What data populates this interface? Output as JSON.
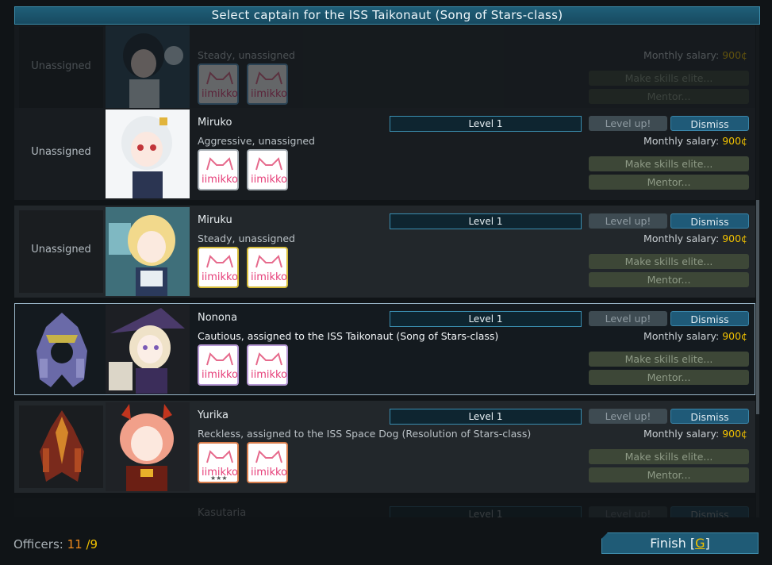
{
  "title": "Select captain for the ISS Taikonaut (Song of Stars-class)",
  "labels": {
    "unassigned": "Unassigned",
    "level_up": "Level up!",
    "dismiss": "Dismiss",
    "monthly_salary": "Monthly salary:",
    "make_elite": "Make skills elite...",
    "mentor": "Mentor...",
    "badge_text": "iimikko"
  },
  "officers": [
    {
      "name": "",
      "description": "Steady, unassigned",
      "level": "",
      "salary": "900¢",
      "ship": "Unassigned",
      "badge_color": "blue"
    },
    {
      "name": "Miruko",
      "description": "Aggressive, unassigned",
      "level": "Level 1",
      "salary": "900¢",
      "ship": "Unassigned",
      "badge_color": "gray"
    },
    {
      "name": "Miruku",
      "description": "Steady, unassigned",
      "level": "Level 1",
      "salary": "900¢",
      "ship": "Unassigned",
      "badge_color": "gold"
    },
    {
      "name": "Nonona",
      "description": "Cautious, assigned to the ISS Taikonaut (Song of Stars-class)",
      "level": "Level 1",
      "salary": "900¢",
      "ship": "",
      "badge_color": "purple"
    },
    {
      "name": "Yurika",
      "description": "Reckless, assigned to the ISS Space Dog (Resolution of Stars-class)",
      "level": "Level 1",
      "salary": "900¢",
      "ship": "",
      "badge_color": "orange"
    },
    {
      "name": "Kasutaria",
      "description": "",
      "level": "Level 1",
      "salary": "",
      "ship": "",
      "badge_color": "gray"
    }
  ],
  "footer": {
    "officers_label": "Officers:",
    "officers_count": "11",
    "officers_max": "/9",
    "finish_label": "Finish [",
    "finish_key": "G",
    "finish_close": "]"
  },
  "colors": {
    "accent": "#1f5b76",
    "salary": "#f2c200",
    "count": "#f08a1c"
  }
}
